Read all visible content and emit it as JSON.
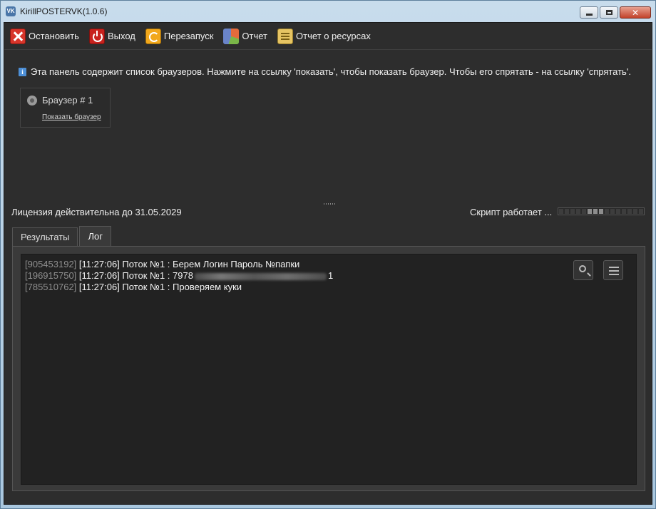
{
  "window": {
    "title": "KirillPOSTERVK(1.0.6)",
    "app_icon": "vk-logo-icon",
    "app_icon_text": "VK",
    "controls": [
      "minimize",
      "maximize",
      "close"
    ]
  },
  "toolbar": {
    "stop_label": "Остановить",
    "exit_label": "Выход",
    "restart_label": "Перезапуск",
    "report_label": "Отчет",
    "resources_label": "Отчет о ресурсах"
  },
  "info": {
    "icon": "info-icon",
    "icon_glyph": "i",
    "text": "Эта панель содержит список браузеров. Нажмите на ссылку 'показать', чтобы показать браузер. Чтобы его спрятать - на ссылку 'спрятать'."
  },
  "browsers": [
    {
      "name": "Браузер # 1",
      "link": "Показать браузер"
    }
  ],
  "status": {
    "license": "Лицензия действительна до 31.05.2029",
    "script": "Скрипт работает ..."
  },
  "tabs": [
    {
      "label": "Результаты",
      "active": false
    },
    {
      "label": "Лог",
      "active": true
    }
  ],
  "log": [
    {
      "id": "[905453192]",
      "text": "[11:27:06] Поток №1 : Берем Логин Пароль №папки"
    },
    {
      "id": "[196915750]",
      "text": "[11:27:06] Поток №1 : 7978",
      "suffix": "1"
    },
    {
      "id": "[785510762]",
      "text": "[11:27:06] Поток №1 : Проверяем куки"
    }
  ],
  "colors": {
    "background": "#2d2d2d",
    "log_background": "#222222",
    "text": "#f0f0f0",
    "log_id": "#8f8f8f"
  }
}
